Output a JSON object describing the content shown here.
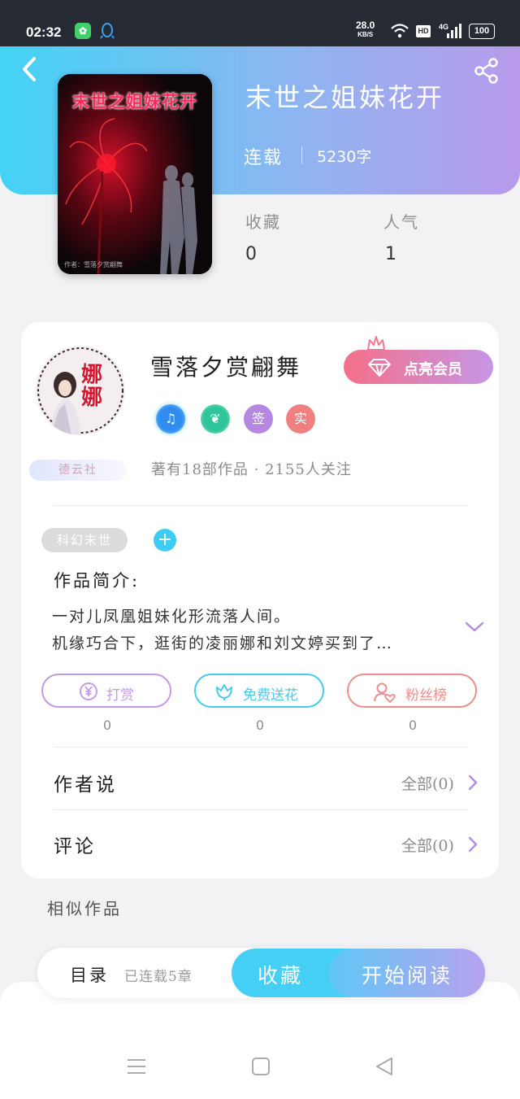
{
  "status_bar": {
    "time": "02:32",
    "app_badge": "✿",
    "speed_value": "28.0",
    "speed_unit": "KB/S",
    "hd": "HD",
    "network": "4G",
    "battery": "100"
  },
  "book": {
    "title": "末世之姐妹花开",
    "cover_title": "末世之姐妹花开",
    "cover_credit": "作者：雪落夕赏翩舞",
    "status": "连载",
    "words": "5230字",
    "stats": [
      {
        "label": "收藏",
        "value": "0"
      },
      {
        "label": "人气",
        "value": "1"
      }
    ]
  },
  "author": {
    "name": "雪落夕赏翩舞",
    "avatar_text": "娜娜",
    "group_badge": "德云社",
    "vip_label": "点亮会员",
    "badges": [
      "♫",
      "❦",
      "签",
      "实"
    ],
    "meta": "著有18部作品 · 2155人关注"
  },
  "tags": {
    "genre": "科幻末世",
    "add": "+"
  },
  "intro": {
    "heading": "作品简介:",
    "line1": "一对儿凤凰姐妹化形流落人间。",
    "line2": "机缘巧合下，逛街的凌丽娜和刘文婷买到了…"
  },
  "actions": [
    {
      "label": "打赏",
      "count": "0",
      "icon": "yen-icon",
      "color": "#c49ae6"
    },
    {
      "label": "免费送花",
      "count": "0",
      "icon": "flower-icon",
      "color": "#46cbef"
    },
    {
      "label": "粉丝榜",
      "count": "0",
      "icon": "fan-icon",
      "color": "#f08c8c"
    }
  ],
  "rows": [
    {
      "title": "作者说",
      "more": "全部(0)"
    },
    {
      "title": "评论",
      "more": "全部(0)"
    }
  ],
  "similar_heading": "相似作品",
  "bottom": {
    "toc": "目录",
    "serial": "已连载5章",
    "collect": "收藏",
    "read": "开始阅读"
  },
  "colors": {
    "header_start": "#43d3f5",
    "header_end": "#b89aeb",
    "accent_cyan": "#45cff4",
    "vip_pink": "#f46f88"
  }
}
